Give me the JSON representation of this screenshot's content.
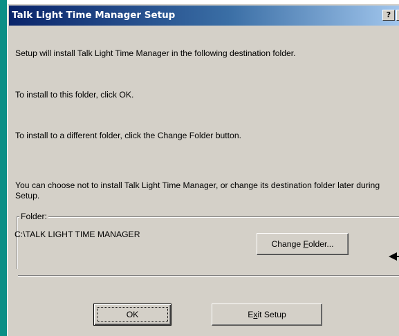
{
  "window": {
    "title": "Talk Light Time Manager Setup",
    "help_button": "?",
    "close_button": "×"
  },
  "messages": [
    "Setup will install Talk Light Time Manager in the following destination folder.",
    "To install to this folder, click OK.",
    "To install to a different folder, click the Change Folder button.",
    "You can choose not to install Talk Light Time Manager, or change its destination folder later during Setup."
  ],
  "folder": {
    "label": "Folder:",
    "path": "C:\\TALK LIGHT TIME MANAGER",
    "change_button": {
      "before": "Change ",
      "accel": "F",
      "after": "older..."
    }
  },
  "buttons": {
    "ok": "OK",
    "exit": {
      "before": "E",
      "accel": "x",
      "after": "it Setup"
    }
  },
  "colors": {
    "titlebar_start": "#0a246a",
    "titlebar_end": "#a6caf0",
    "dialog_face": "#d4d0c8",
    "desktop_strip": "#0b8f86"
  },
  "icons": {
    "pointer": "arrow-pointer-icon"
  }
}
